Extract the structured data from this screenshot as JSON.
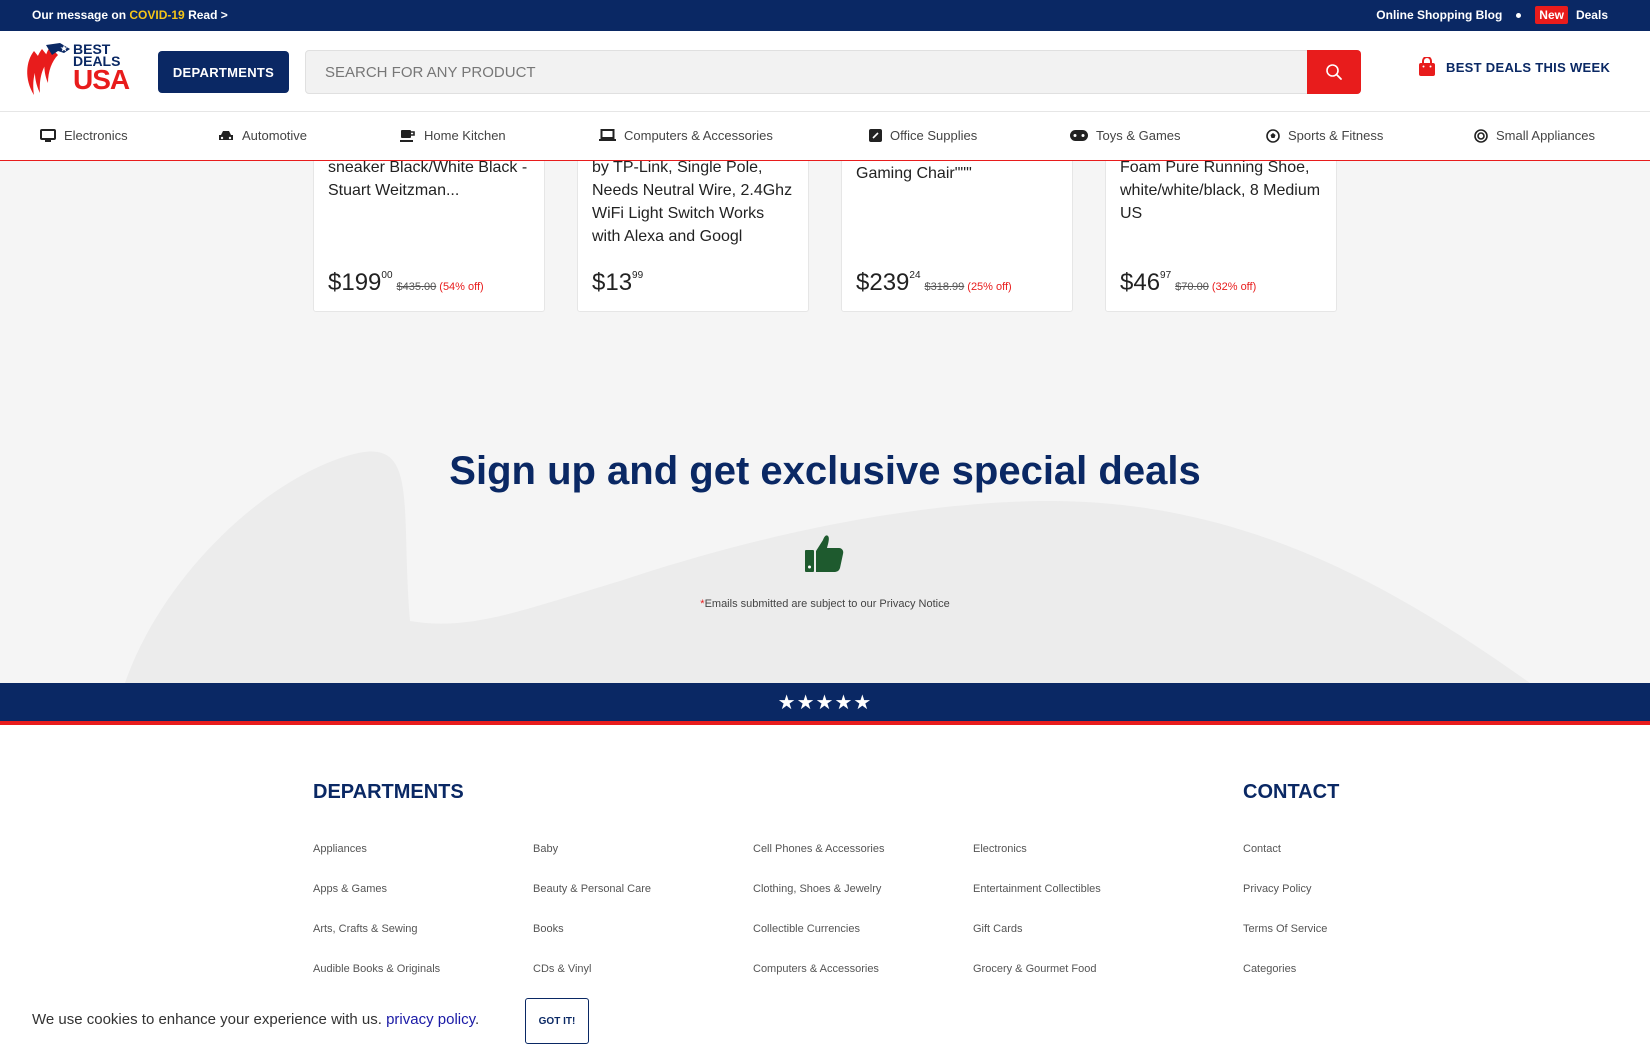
{
  "topbar": {
    "message_prefix": "Our message on",
    "covid": "COVID-19",
    "read": "Read >",
    "blog": "Online Shopping Blog",
    "new_badge": "New",
    "deals": "Deals"
  },
  "header": {
    "logo_best": "BEST",
    "logo_deals": "DEALS",
    "logo_usa": "USA",
    "departments_button": "DEPARTMENTS",
    "search_placeholder": "SEARCH FOR ANY PRODUCT",
    "best_deals": "BEST DEALS THIS WEEK"
  },
  "categories": [
    {
      "label": "Electronics",
      "icon": "monitor-icon"
    },
    {
      "label": "Automotive",
      "icon": "car-icon"
    },
    {
      "label": "Home Kitchen",
      "icon": "coffee-cup-icon"
    },
    {
      "label": "Computers & Accessories",
      "icon": "laptop-icon"
    },
    {
      "label": "Office Supplies",
      "icon": "pen-square-icon"
    },
    {
      "label": "Toys & Games",
      "icon": "gamepad-icon"
    },
    {
      "label": "Sports & Fitness",
      "icon": "soccer-ball-icon"
    },
    {
      "label": "Small Appliances",
      "icon": "ring-icon"
    }
  ],
  "products": [
    {
      "title": "sneaker Black/White Black - Stuart Weitzman...",
      "dollars": "$199",
      "cents": "00",
      "old_price": "$435.00",
      "off": "(54% off)"
    },
    {
      "title": "by TP-Link, Single Pole, Needs Neutral Wire, 2.4Ghz WiFi Light Switch Works with Alexa and Googl",
      "dollars": "$13",
      "cents": "99",
      "old_price": "",
      "off": ""
    },
    {
      "title": "Gaming Chair\"\"\"",
      "dollars": "$239",
      "cents": "24",
      "old_price": "$318.99",
      "off": "(25% off)"
    },
    {
      "title": "Foam Pure Running Shoe, white/white/black, 8 Medium US",
      "dollars": "$46",
      "cents": "97",
      "old_price": "$70.00",
      "off": "(32% off)"
    }
  ],
  "signup": {
    "title": "Sign up and get exclusive special deals",
    "notice_star": "*",
    "notice": "Emails submitted are subject to our Privacy Notice"
  },
  "stars": "★★★★★",
  "footer": {
    "departments_heading": "DEPARTMENTS",
    "contact_heading": "CONTACT",
    "col1": [
      "Appliances",
      "Apps & Games",
      "Arts, Crafts & Sewing",
      "Audible Books & Originals"
    ],
    "col2": [
      "Baby",
      "Beauty & Personal Care",
      "Books",
      "CDs & Vinyl"
    ],
    "col3": [
      "Cell Phones & Accessories",
      "Clothing, Shoes & Jewelry",
      "Collectible Currencies",
      "Computers & Accessories"
    ],
    "col4": [
      "Electronics",
      "Entertainment Collectibles",
      "Gift Cards",
      "Grocery & Gourmet Food"
    ],
    "contact": [
      "Contact",
      "Privacy Policy",
      "Terms Of Service",
      "Categories"
    ]
  },
  "cookie": {
    "text": "We use cookies to enhance your experience with us.",
    "link": "privacy policy",
    "period": ".",
    "button": "GOT IT!"
  },
  "colors": {
    "navy": "#0a2864",
    "red": "#e81c1c",
    "thumb_green": "#1e5a2e"
  }
}
